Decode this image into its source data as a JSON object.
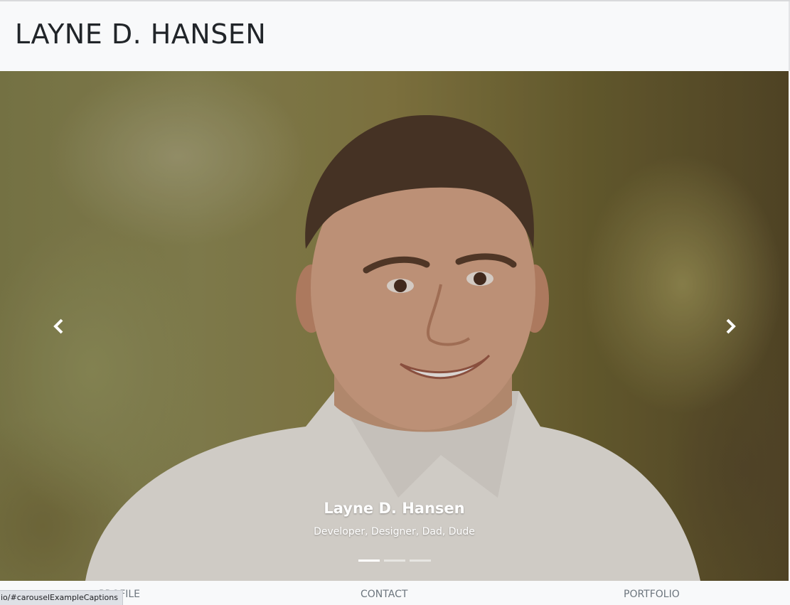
{
  "header": {
    "brand": "LAYNE D. HANSEN"
  },
  "carousel": {
    "caption_title": "Layne D. Hansen",
    "caption_subtitle": "Developer, Designer, Dad, Dude",
    "slide_count": 3,
    "active_slide": 1
  },
  "nav": {
    "items": [
      "PROFILE",
      "CONTACT",
      "PORTFOLIO"
    ]
  },
  "status_bar": {
    "url": "io/#carouselExampleCaptions"
  }
}
